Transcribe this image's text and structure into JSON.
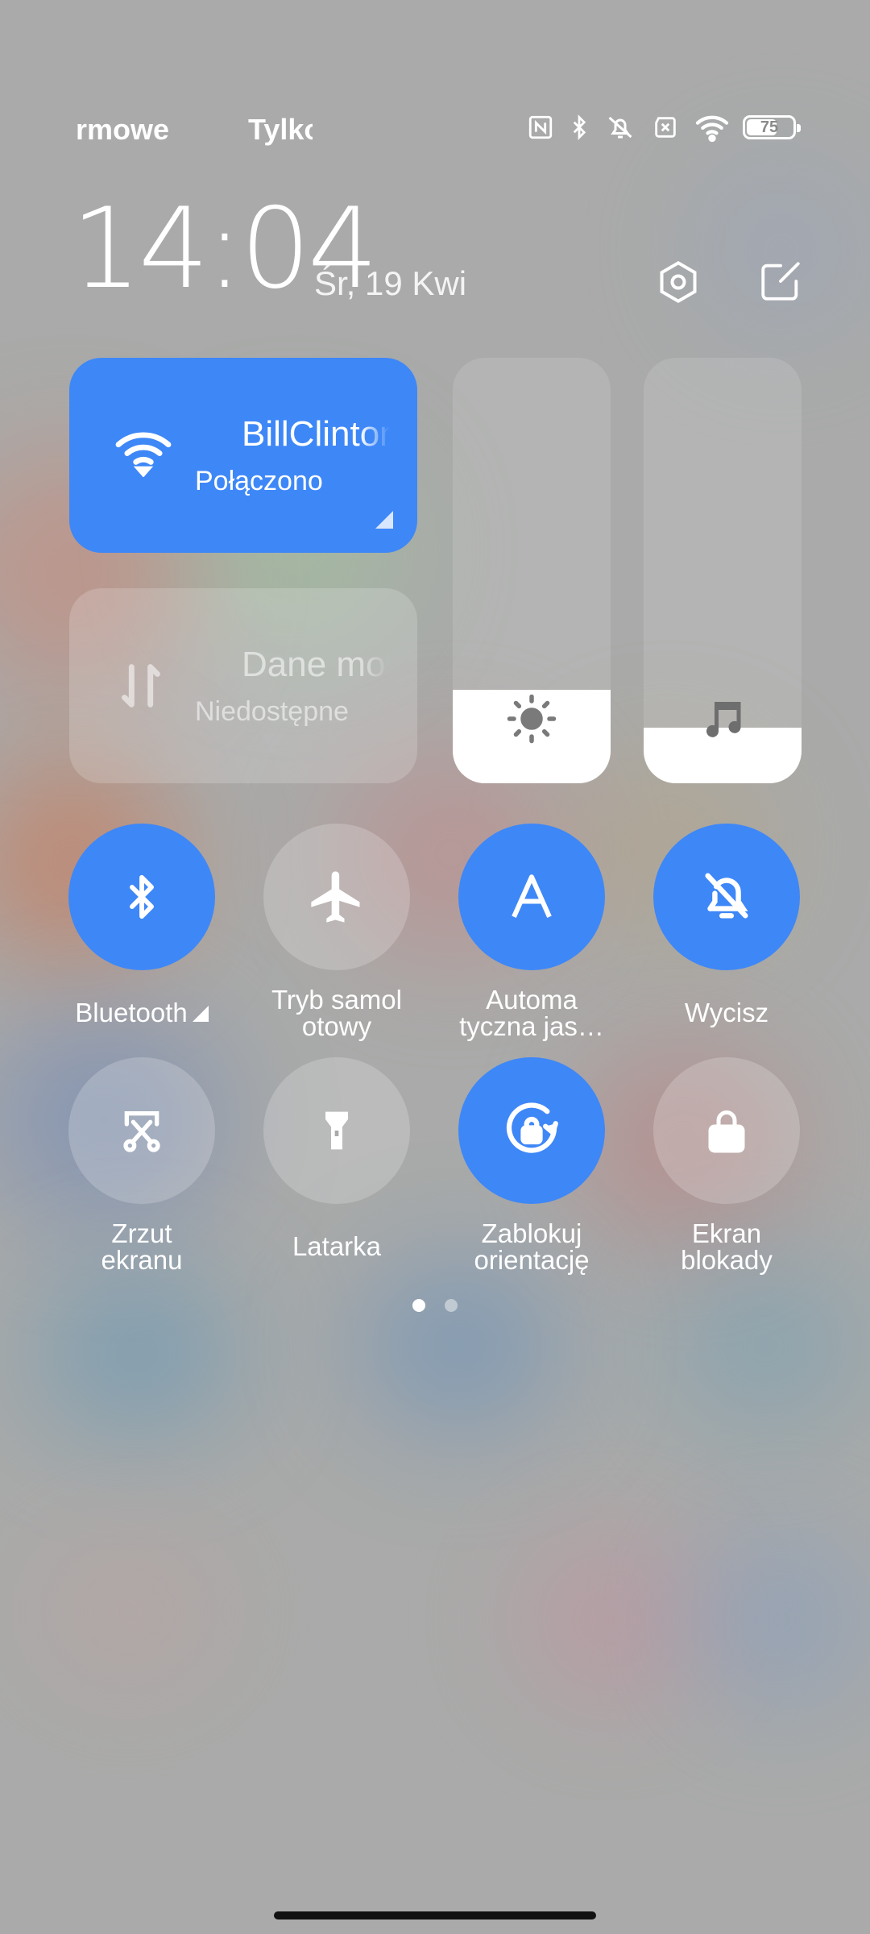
{
  "status_bar": {
    "left_text_1": "rmowe",
    "left_text_2": "Tylko",
    "icons": [
      "nfc-icon",
      "bluetooth-icon",
      "mute-icon",
      "no-sim-icon",
      "wifi-icon",
      "battery-icon"
    ],
    "battery_level": "75"
  },
  "header": {
    "time": "14:04",
    "date": "Śr, 19 Kwi",
    "buttons": [
      "settings-icon",
      "edit-icon"
    ]
  },
  "tiles": {
    "wifi": {
      "name": "BillClinton",
      "status": "Połączono",
      "active": true
    },
    "mobile_data": {
      "name": "Dane mobilne",
      "status": "Niedostępne",
      "active": false
    }
  },
  "sliders": {
    "brightness": {
      "icon": "sun-icon",
      "level": 0.22
    },
    "volume": {
      "icon": "music-note-icon",
      "level": 0.13
    }
  },
  "toggles": [
    {
      "label": "Bluetooth",
      "icon": "bluetooth-icon",
      "on": true
    },
    {
      "label": "Tryb samol otowy",
      "icon": "airplane-icon",
      "on": false
    },
    {
      "label": "Automa tyczna jas…",
      "icon": "auto-brightness-icon",
      "on": true
    },
    {
      "label": "Wycisz",
      "icon": "mute-bell-icon",
      "on": true
    },
    {
      "label": "Zrzut ekranu",
      "icon": "screenshot-icon",
      "on": false
    },
    {
      "label": "Latarka",
      "icon": "flashlight-icon",
      "on": false
    },
    {
      "label": "Zablokuj orientację",
      "icon": "rotation-lock-icon",
      "on": true
    },
    {
      "label": "Ekran blokady",
      "icon": "lock-icon",
      "on": false
    }
  ],
  "toggle_labels": {
    "bluetooth": "Bluetooth",
    "airplane_1": "Tryb samol",
    "airplane_2": "otowy",
    "auto_1": "Automa",
    "auto_2": "tyczna jas…",
    "mute": "Wycisz",
    "screenshot_1": "Zrzut",
    "screenshot_2": "ekranu",
    "flashlight": "Latarka",
    "rotation_1": "Zablokuj",
    "rotation_2": "orientację",
    "lock_1": "Ekran",
    "lock_2": "blokady"
  },
  "pager": {
    "pages": 2,
    "current": 1
  },
  "colors": {
    "accent": "#3e87f7",
    "panel_bg": "#a9aaa9"
  }
}
